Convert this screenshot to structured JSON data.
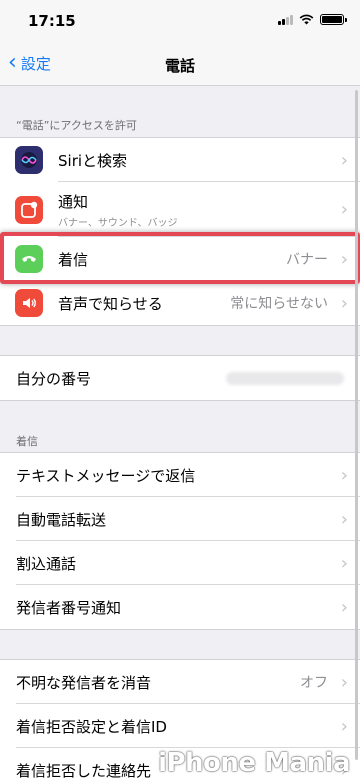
{
  "status_bar": {
    "time": "17:15"
  },
  "nav": {
    "back_label": "設定",
    "title": "電話"
  },
  "access_section": {
    "header": "“電話”にアクセスを許可",
    "items": [
      {
        "label": "Siriと検索",
        "icon": "siri-icon"
      },
      {
        "label": "通知",
        "subtitle": "バナー、サウンド、バッジ",
        "icon": "notifications-icon"
      },
      {
        "label": "着信",
        "value": "バナー",
        "icon": "phone-icon"
      },
      {
        "label": "音声で知らせる",
        "value": "常に知らせない",
        "icon": "speaker-icon"
      }
    ]
  },
  "my_number": {
    "label": "自分の番号"
  },
  "incoming_section": {
    "header": "着信",
    "items": [
      {
        "label": "テキストメッセージで返信"
      },
      {
        "label": "自動電話転送"
      },
      {
        "label": "割込通話"
      },
      {
        "label": "発信者番号通知"
      }
    ]
  },
  "block_section": {
    "items": [
      {
        "label": "不明な発信者を消音",
        "value": "オフ"
      },
      {
        "label": "着信拒否設定と着信ID"
      },
      {
        "label": "着信拒否した連絡先"
      }
    ]
  },
  "watermark": "iPhone Mania",
  "colors": {
    "accent": "#1479f5",
    "highlight": "#e54855",
    "siri": "#3a3a8c",
    "notifications": "#f04a3a",
    "phone": "#5ccf5a",
    "speaker": "#f04a3a"
  }
}
